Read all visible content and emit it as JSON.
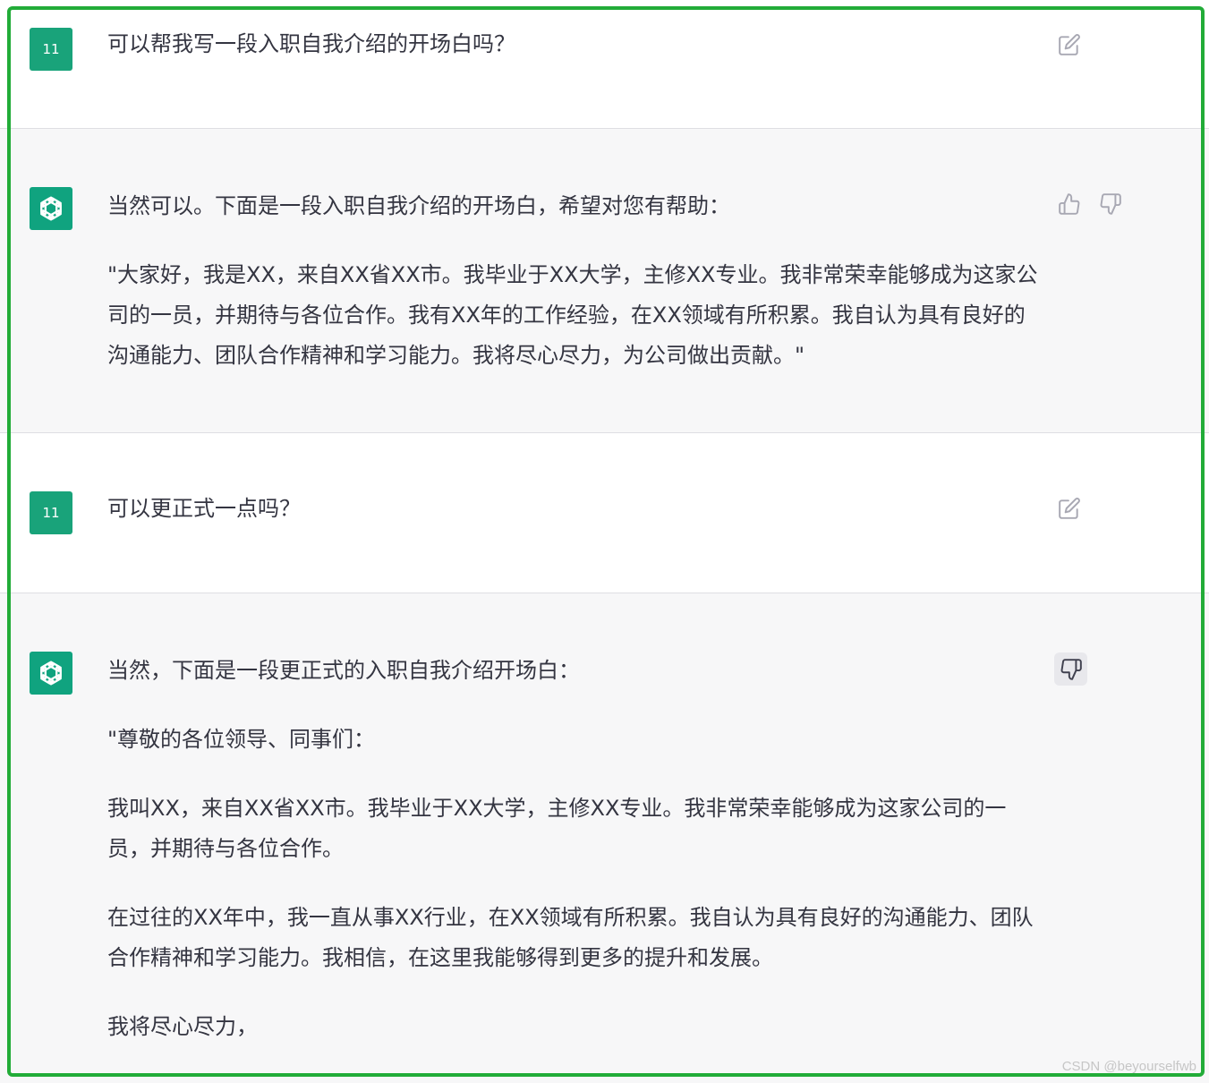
{
  "conversation": [
    {
      "role": "user",
      "avatar_text": "11",
      "text": "可以帮我写一段入职自我介绍的开场白吗？"
    },
    {
      "role": "assistant",
      "paragraphs": [
        "当然可以。下面是一段入职自我介绍的开场白，希望对您有帮助：",
        "\"大家好，我是XX，来自XX省XX市。我毕业于XX大学，主修XX专业。我非常荣幸能够成为这家公司的一员，并期待与各位合作。我有XX年的工作经验，在XX领域有所积累。我自认为具有良好的沟通能力、团队合作精神和学习能力。我将尽心尽力，为公司做出贡献。\""
      ]
    },
    {
      "role": "user",
      "avatar_text": "11",
      "text": "可以更正式一点吗？"
    },
    {
      "role": "assistant",
      "paragraphs": [
        "当然，下面是一段更正式的入职自我介绍开场白：",
        "\"尊敬的各位领导、同事们：",
        "我叫XX，来自XX省XX市。我毕业于XX大学，主修XX专业。我非常荣幸能够成为这家公司的一员，并期待与各位合作。",
        "在过往的XX年中，我一直从事XX行业，在XX领域有所积累。我自认为具有良好的沟通能力、团队合作精神和学习能力。我相信，在这里我能够得到更多的提升和发展。",
        "我将尽心尽力，"
      ]
    }
  ],
  "icons": {
    "edit": "edit-icon",
    "thumbs_up": "thumbs-up-icon",
    "thumbs_down": "thumbs-down-icon",
    "assistant_logo": "openai-logo-icon"
  },
  "colors": {
    "frame_border": "#22ac38",
    "user_avatar": "#19a37a",
    "assistant_avatar": "#10a37f",
    "assistant_row_bg": "#f7f7f8"
  },
  "watermark": "CSDN @beyourselfwb"
}
